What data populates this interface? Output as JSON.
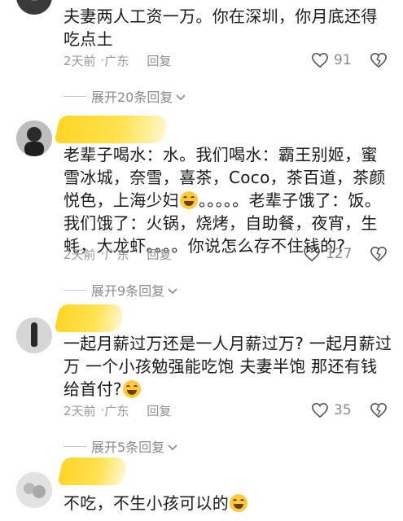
{
  "comments": [
    {
      "text": "夫妻两人工资一万。你在深圳，你月底还得吃点土",
      "time": "2天前",
      "location": "广东",
      "reply_label": "回复",
      "likes": "91",
      "expand_label": "展开20条回复"
    },
    {
      "text_parts": [
        "老辈子喝水：水。我们喝水：霸王别姬，蜜雪冰城，奈雪，喜茶，Coco，茶百道，茶颜悦色，上海少妇",
        "。。。。。老辈子饿了：饭。我们饿了：火锅，烧烤，自助餐，夜宵，生蚝，大龙虾。。。。你说怎么存不住钱的?"
      ],
      "time": "2天前",
      "location": "广东",
      "reply_label": "回复",
      "likes": "127",
      "expand_label": "展开9条回复"
    },
    {
      "text_parts": [
        "一起月薪过万还是一人月薪过万? 一起月薪过万 一个小孩勉强能吃饱 夫妻半饱 那还有钱给首付?",
        ""
      ],
      "time": "2天前",
      "location": "广东",
      "reply_label": "回复",
      "likes": "35",
      "expand_label": "展开5条回复"
    },
    {
      "text_parts": [
        "不吃，不生小孩可以的",
        ""
      ]
    }
  ],
  "separator": "·",
  "icons": {
    "like": "heart-outline-icon",
    "dislike": "broken-heart-icon",
    "chevron": "chevron-down-icon",
    "emoji_smile": "grinning-sweat-emoji-icon",
    "emoji_laugh": "tears-of-joy-emoji-icon"
  },
  "colors": {
    "highlight": "#ffd21a",
    "meta": "#9a9a9a",
    "text": "#1a1a1a"
  }
}
